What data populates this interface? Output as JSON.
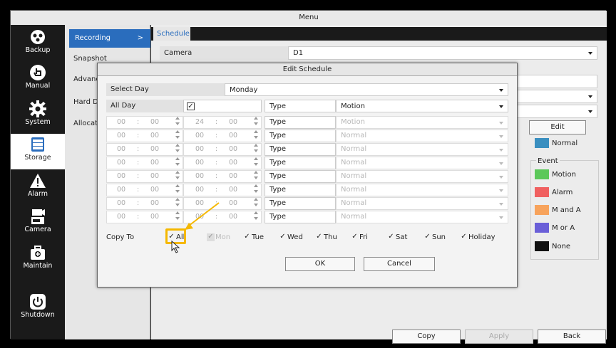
{
  "window": {
    "title": "Menu"
  },
  "nav": [
    {
      "label": "Backup",
      "icon": "backup-icon"
    },
    {
      "label": "Manual",
      "icon": "manual-icon"
    },
    {
      "label": "System",
      "icon": "gear-icon"
    },
    {
      "label": "Storage",
      "icon": "storage-icon"
    },
    {
      "label": "Alarm",
      "icon": "alarm-icon"
    },
    {
      "label": "Camera",
      "icon": "camera-icon"
    },
    {
      "label": "Maintain",
      "icon": "maintain-icon"
    },
    {
      "label": "Shutdown",
      "icon": "power-icon"
    }
  ],
  "submenu": [
    {
      "label": "Recording",
      "chevron": ">"
    },
    {
      "label": "Snapshot"
    },
    {
      "label": "Advanc"
    },
    {
      "label": "Hard D"
    },
    {
      "label": "Allocate"
    }
  ],
  "tab": "Schedule",
  "camera": {
    "label": "Camera",
    "value": "D1"
  },
  "edit_button": "Edit",
  "legend_title": "Event",
  "legend": [
    {
      "label": "Normal",
      "color": "#3a8fc0"
    },
    {
      "label": "Motion",
      "color": "#5cc85a"
    },
    {
      "label": "Alarm",
      "color": "#f06060"
    },
    {
      "label": "M and A",
      "color": "#f7a35c"
    },
    {
      "label": "M or A",
      "color": "#6a5fd8"
    },
    {
      "label": "None",
      "color": "#111111"
    }
  ],
  "footer": {
    "copy": "Copy",
    "apply": "Apply",
    "back": "Back"
  },
  "dialog": {
    "title": "Edit Schedule",
    "select_day_label": "Select Day",
    "select_day_value": "Monday",
    "all_day_label": "All Day",
    "all_day_checked": "✓",
    "type_label": "Type",
    "type_value": "Motion",
    "rows": [
      {
        "start_h": "00",
        "start_m": "00",
        "end_h": "24",
        "end_m": "00",
        "type_label": "Type",
        "type_value": "Motion"
      },
      {
        "start_h": "00",
        "start_m": "00",
        "end_h": "00",
        "end_m": "00",
        "type_label": "Type",
        "type_value": "Normal"
      },
      {
        "start_h": "00",
        "start_m": "00",
        "end_h": "00",
        "end_m": "00",
        "type_label": "Type",
        "type_value": "Normal"
      },
      {
        "start_h": "00",
        "start_m": "00",
        "end_h": "00",
        "end_m": "00",
        "type_label": "Type",
        "type_value": "Normal"
      },
      {
        "start_h": "00",
        "start_m": "00",
        "end_h": "00",
        "end_m": "00",
        "type_label": "Type",
        "type_value": "Normal"
      },
      {
        "start_h": "00",
        "start_m": "00",
        "end_h": "00",
        "end_m": "00",
        "type_label": "Type",
        "type_value": "Normal"
      },
      {
        "start_h": "00",
        "start_m": "00",
        "end_h": "00",
        "end_m": "00",
        "type_label": "Type",
        "type_value": "Normal"
      },
      {
        "start_h": "00",
        "start_m": "00",
        "end_h": "00",
        "end_m": "00",
        "type_label": "Type",
        "type_value": "Normal"
      }
    ],
    "time_sep": ":",
    "copy_to_label": "Copy To",
    "copy_to": [
      {
        "label": "All",
        "checked": "✓"
      },
      {
        "label": "Mon",
        "checked": "✓"
      },
      {
        "label": "Tue",
        "checked": "✓"
      },
      {
        "label": "Wed",
        "checked": "✓"
      },
      {
        "label": "Thu",
        "checked": "✓"
      },
      {
        "label": "Fri",
        "checked": "✓"
      },
      {
        "label": "Sat",
        "checked": "✓"
      },
      {
        "label": "Sun",
        "checked": "✓"
      },
      {
        "label": "Holiday",
        "checked": "✓"
      }
    ],
    "ok": "OK",
    "cancel": "Cancel"
  },
  "highlight_color": "#f5b800"
}
